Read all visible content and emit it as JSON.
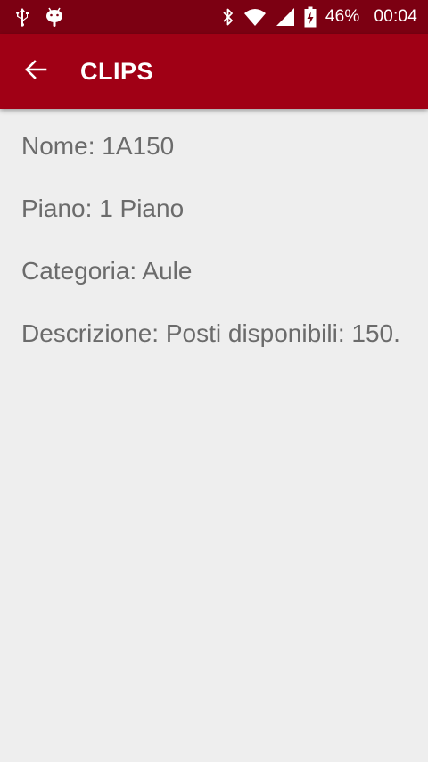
{
  "status_bar": {
    "icons_left": [
      "usb-icon",
      "android-debug-icon"
    ],
    "icons_right": [
      "bluetooth-icon",
      "wifi-icon",
      "cell-signal-icon",
      "battery-charging-icon"
    ],
    "battery_percent": "46%",
    "time": "00:04"
  },
  "app_bar": {
    "title": "CLIPS",
    "back_icon": "arrow-back-icon"
  },
  "details": {
    "nome": {
      "label": "Nome:",
      "value": "1A150"
    },
    "piano": {
      "label": "Piano:",
      "value": "1 Piano"
    },
    "categoria": {
      "label": "Categoria:",
      "value": "Aule"
    },
    "descrizione": {
      "label": "Descrizione:",
      "value": "Posti disponibili: 150."
    }
  },
  "colors": {
    "status_bar": "#7c0012",
    "app_bar": "#a00015",
    "background": "#eeeeee",
    "text": "#6b6b6b"
  }
}
